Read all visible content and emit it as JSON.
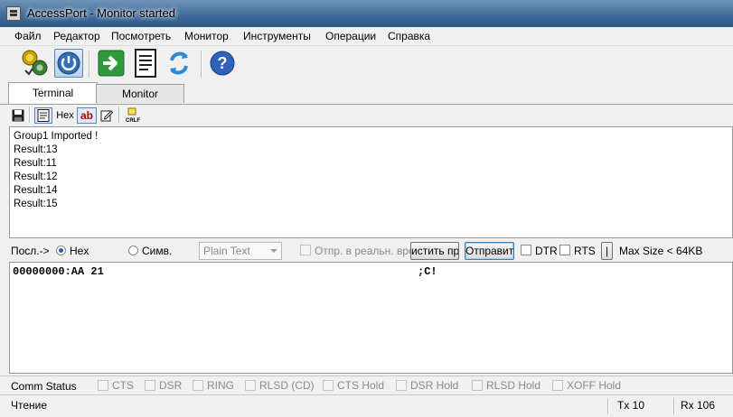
{
  "window": {
    "title": "AccessPort - Monitor  started"
  },
  "menu": [
    "Файл",
    "Редактор",
    "Посмотреть",
    "Монитор",
    "Инструменты",
    "Операции",
    "Справка"
  ],
  "toolbar": {
    "icons": [
      "settings-coins-icon",
      "power-icon",
      "arrow-right-icon",
      "document-icon",
      "refresh-icon",
      "help-icon"
    ]
  },
  "tabs": [
    {
      "label": "Terminal",
      "selected": true
    },
    {
      "label": "Monitor",
      "selected": false
    }
  ],
  "small_toolbar": {
    "hex_label": "Hex",
    "ab_label": "ab",
    "crlf_label": "CRLF"
  },
  "receive": {
    "lines": [
      "Group1 Imported !",
      "Result:13",
      "Result:11",
      "Result:12",
      "Result:14",
      "Result:15"
    ]
  },
  "send_options": {
    "send_label": "Посл.->",
    "hex_label": "Hex",
    "hex_selected": true,
    "char_label": "Симв.",
    "format_value": "Plain Text",
    "realtime_label": "Отпр. в реальн. вре",
    "clear_button": "истить при",
    "send_button": "Отправить",
    "dtr_label": "DTR",
    "rts_label": "RTS",
    "pipe_button": "|",
    "max_size": "Max Size < 64KB"
  },
  "send_area": {
    "hex_text": "00000000:AA 21",
    "ascii_text": ";C!"
  },
  "comm_status": {
    "label": "Comm Status",
    "signals": [
      "CTS",
      "DSR",
      "RING",
      "RLSD (CD)",
      "CTS Hold",
      "DSR Hold",
      "RLSD Hold",
      "XOFF Hold"
    ]
  },
  "status_bar": {
    "state": "Чтение",
    "tx": "Tx 10",
    "rx": "Rx 106"
  },
  "colors": {
    "title_bar": "#3f6a97",
    "accent": "#2a5fb0"
  }
}
